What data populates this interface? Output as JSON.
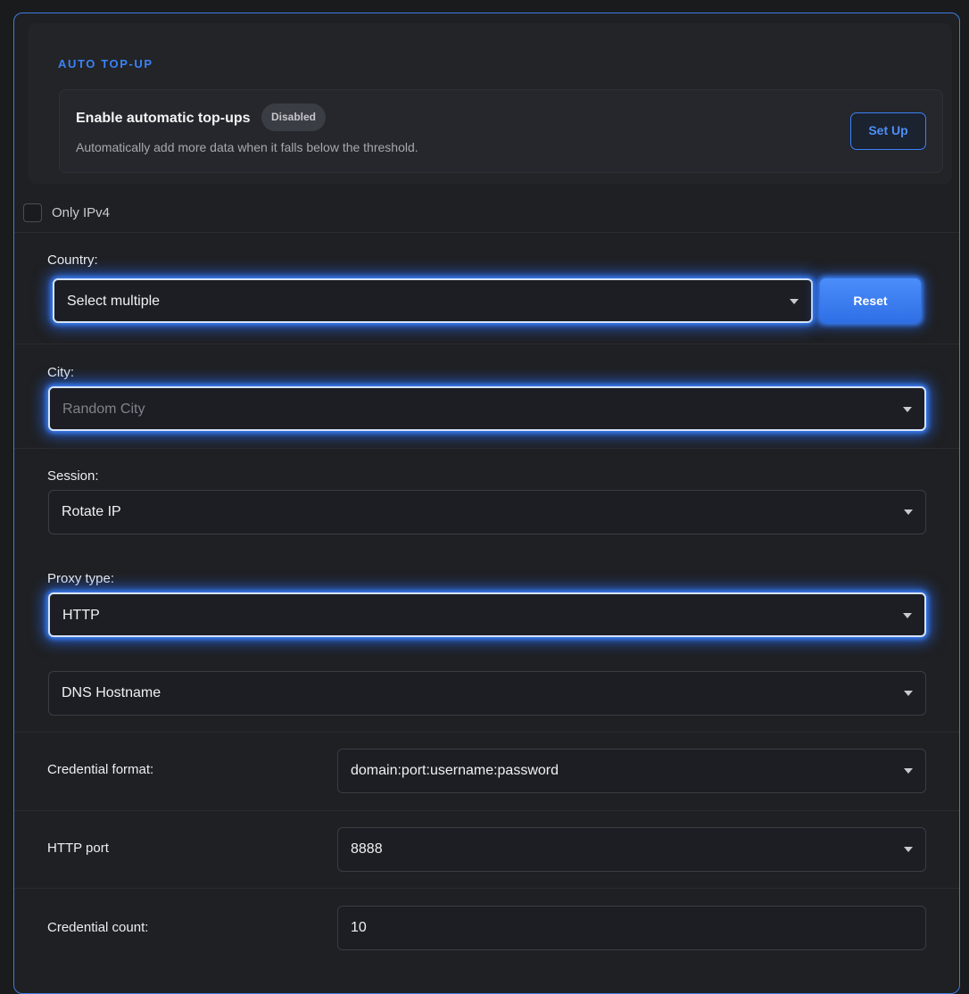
{
  "topup": {
    "heading": "AUTO TOP-UP",
    "title": "Enable automatic top-ups",
    "status": "Disabled",
    "description": "Automatically add more data when it falls below the threshold.",
    "setup_label": "Set Up"
  },
  "ipv4": {
    "label": "Only IPv4",
    "checked": false
  },
  "country": {
    "label": "Country:",
    "value": "Select multiple",
    "reset_label": "Reset"
  },
  "city": {
    "label": "City:",
    "placeholder": "Random City"
  },
  "session": {
    "label": "Session:",
    "value": "Rotate IP"
  },
  "proxy_type": {
    "label": "Proxy type:",
    "value": "HTTP"
  },
  "dns": {
    "value": "DNS Hostname"
  },
  "credential_format": {
    "label": "Credential format:",
    "value": "domain:port:username:password"
  },
  "http_port": {
    "label": "HTTP port",
    "value": "8888"
  },
  "credential_count": {
    "label": "Credential count:",
    "value": "10"
  },
  "colors": {
    "accent": "#3b82f6",
    "border_glow": "#3d86ff",
    "background": "#1a1b1d"
  }
}
